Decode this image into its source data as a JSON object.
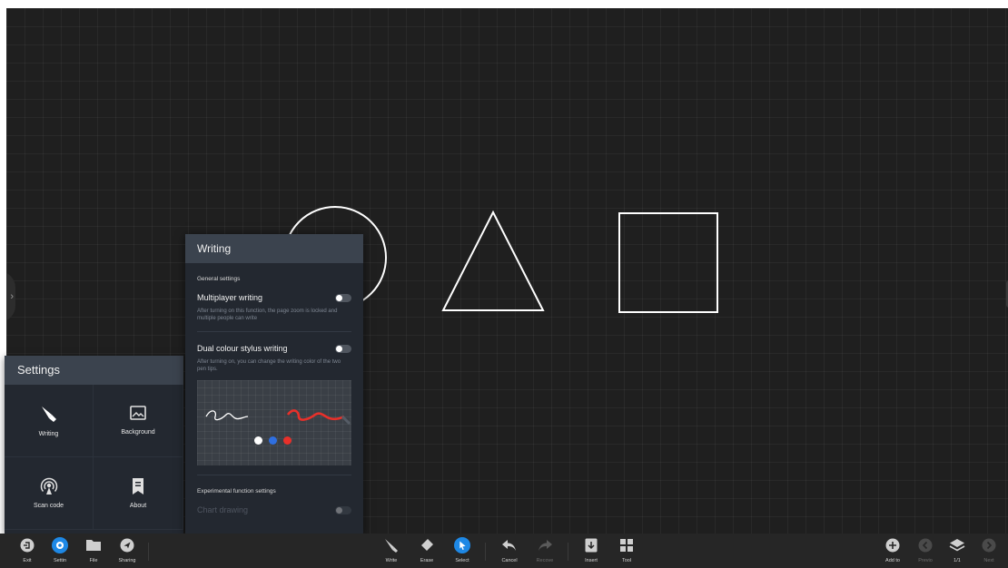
{
  "settings": {
    "title": "Settings",
    "items": [
      {
        "label": "Writing",
        "icon": "pen-icon"
      },
      {
        "label": "Background",
        "icon": "image-icon"
      },
      {
        "label": "Scan code",
        "icon": "broadcast-icon"
      },
      {
        "label": "About",
        "icon": "bookmark-icon"
      }
    ]
  },
  "writing": {
    "title": "Writing",
    "general_section": "General settings",
    "multiplayer": {
      "label": "Multiplayer writing",
      "description": "After turning on this function, the page zoom is locked and multiple people can write",
      "enabled": false
    },
    "dual_colour": {
      "label": "Dual colour stylus writing",
      "description": "After turning on, you can change the writing color of the two pen tips.",
      "enabled": false,
      "colors": [
        "#ffffff",
        "#2f6fe0",
        "#e8302a"
      ]
    },
    "experimental_section": "Experimental function settings",
    "chart_drawing": {
      "label": "Chart drawing",
      "enabled": false
    }
  },
  "toolbar": {
    "left": [
      {
        "label": "Exit",
        "icon": "exit-icon"
      },
      {
        "label": "Settin",
        "icon": "settings-icon",
        "active": true
      },
      {
        "label": "File",
        "icon": "folder-icon"
      },
      {
        "label": "Sharing",
        "icon": "share-icon"
      }
    ],
    "center": [
      {
        "label": "Write",
        "icon": "pen-icon"
      },
      {
        "label": "Erase",
        "icon": "eraser-icon"
      },
      {
        "label": "Select",
        "icon": "select-icon",
        "active": true
      },
      {
        "label": "Cancel",
        "icon": "undo-icon"
      },
      {
        "label": "Recove",
        "icon": "redo-icon",
        "disabled": true
      },
      {
        "label": "Insert",
        "icon": "insert-icon"
      },
      {
        "label": "Tool",
        "icon": "tools-icon"
      }
    ],
    "right": [
      {
        "label": "Add to",
        "icon": "add-page-icon"
      },
      {
        "label": "Previo",
        "icon": "prev-page-icon",
        "disabled": true
      },
      {
        "label": "1/1",
        "icon": "layers-icon"
      },
      {
        "label": "Next",
        "icon": "next-page-icon",
        "disabled": true
      }
    ]
  },
  "colors": {
    "canvas": "#1f1f1f",
    "panel": "#232830",
    "panel_header": "#3b434e",
    "accent": "#1e88e5",
    "stroke": "#ffffff"
  }
}
